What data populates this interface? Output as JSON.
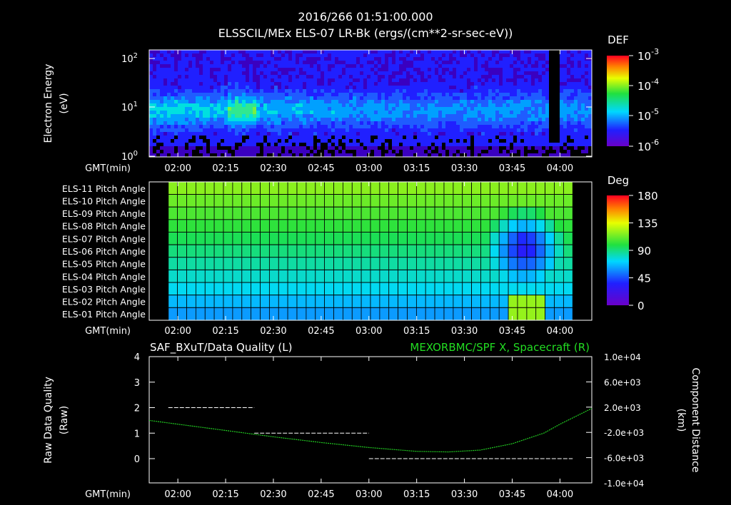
{
  "header": {
    "timestamp": "2016/266 01:51:00.000",
    "title": "ELSSCIL/MEx ELS-07 LR-Bk  (ergs/(cm**2-sr-sec-eV))"
  },
  "colors": {
    "background": "#000000",
    "axis": "#ffffff",
    "grid": "#000000",
    "spacecraft_line": "#22cc22",
    "quality_line": "#ffffff",
    "right_title": "#22dd22"
  },
  "chart_data": [
    {
      "id": "spectrogram",
      "type": "heatmap",
      "ylabel": "Electron Energy",
      "ylabel_unit": "(eV)",
      "xlabel": "GMT(min)",
      "x_ticks": [
        "02:00",
        "02:15",
        "02:30",
        "02:45",
        "03:00",
        "03:15",
        "03:30",
        "03:45",
        "04:00"
      ],
      "y_scale": "log",
      "y_ticks": [
        {
          "base": "10",
          "exp": "0"
        },
        {
          "base": "10",
          "exp": "1"
        },
        {
          "base": "10",
          "exp": "2"
        }
      ],
      "colorbar": {
        "label": "DEF",
        "ticks": [
          {
            "base": "10",
            "exp": "-3"
          },
          {
            "base": "10",
            "exp": "-4"
          },
          {
            "base": "10",
            "exp": "-5"
          },
          {
            "base": "10",
            "exp": "-6"
          }
        ]
      }
    },
    {
      "id": "pitch",
      "type": "heatmap",
      "xlabel": "GMT(min)",
      "x_ticks": [
        "02:00",
        "02:15",
        "02:30",
        "02:45",
        "03:00",
        "03:15",
        "03:30",
        "03:45",
        "04:00"
      ],
      "rows": [
        "ELS-11 Pitch Angle",
        "ELS-10 Pitch Angle",
        "ELS-09 Pitch Angle",
        "ELS-08 Pitch Angle",
        "ELS-07 Pitch Angle",
        "ELS-06 Pitch Angle",
        "ELS-05 Pitch Angle",
        "ELS-04 Pitch Angle",
        "ELS-03 Pitch Angle",
        "ELS-02 Pitch Angle",
        "ELS-01 Pitch Angle"
      ],
      "colorbar": {
        "label": "Deg",
        "ticks": [
          "180",
          "135",
          "90",
          "45",
          "0"
        ],
        "range": [
          0,
          180
        ]
      }
    },
    {
      "id": "lines",
      "type": "line",
      "title_left": "SAF_BXuT/Data Quality (L)",
      "title_right": "MEXORBMC/SPF X, Spacecraft (R)",
      "ylabel_left": "Raw Data Quality",
      "ylabel_left_unit": "(Raw)",
      "ylabel_right": "Component Distance",
      "ylabel_right_unit": "(km)",
      "xlabel": "GMT(min)",
      "x_ticks": [
        "02:00",
        "02:15",
        "02:30",
        "02:45",
        "03:00",
        "03:15",
        "03:30",
        "03:45",
        "04:00"
      ],
      "y_left_ticks": [
        "4",
        "3",
        "2",
        "1",
        "0"
      ],
      "y_left_range": [
        0,
        4
      ],
      "y_right_ticks": [
        "1.0e+04",
        "6.0e+03",
        "2.0e+03",
        "-2.0e+03",
        "-6.0e+03",
        "-1.0e+04"
      ],
      "y_right_range": [
        -10000,
        10000
      ],
      "series": [
        {
          "name": "SAF_BXuT/Data Quality",
          "axis": "left",
          "segments": [
            {
              "start": "01:57",
              "end": "02:24",
              "value": 2
            },
            {
              "start": "02:24",
              "end": "03:00",
              "value": 1
            },
            {
              "start": "03:00",
              "end": "04:04",
              "value": 0
            }
          ]
        },
        {
          "name": "MEXORBMC/SPF X, Spacecraft",
          "axis": "right",
          "x": [
            "01:51",
            "02:00",
            "02:15",
            "02:30",
            "02:45",
            "03:00",
            "03:15",
            "03:25",
            "03:35",
            "03:45",
            "03:55",
            "04:00",
            "04:10"
          ],
          "y": [
            -100,
            -700,
            -1700,
            -2700,
            -3600,
            -4400,
            -5000,
            -5100,
            -4800,
            -3800,
            -2100,
            -700,
            1800
          ]
        }
      ]
    }
  ]
}
